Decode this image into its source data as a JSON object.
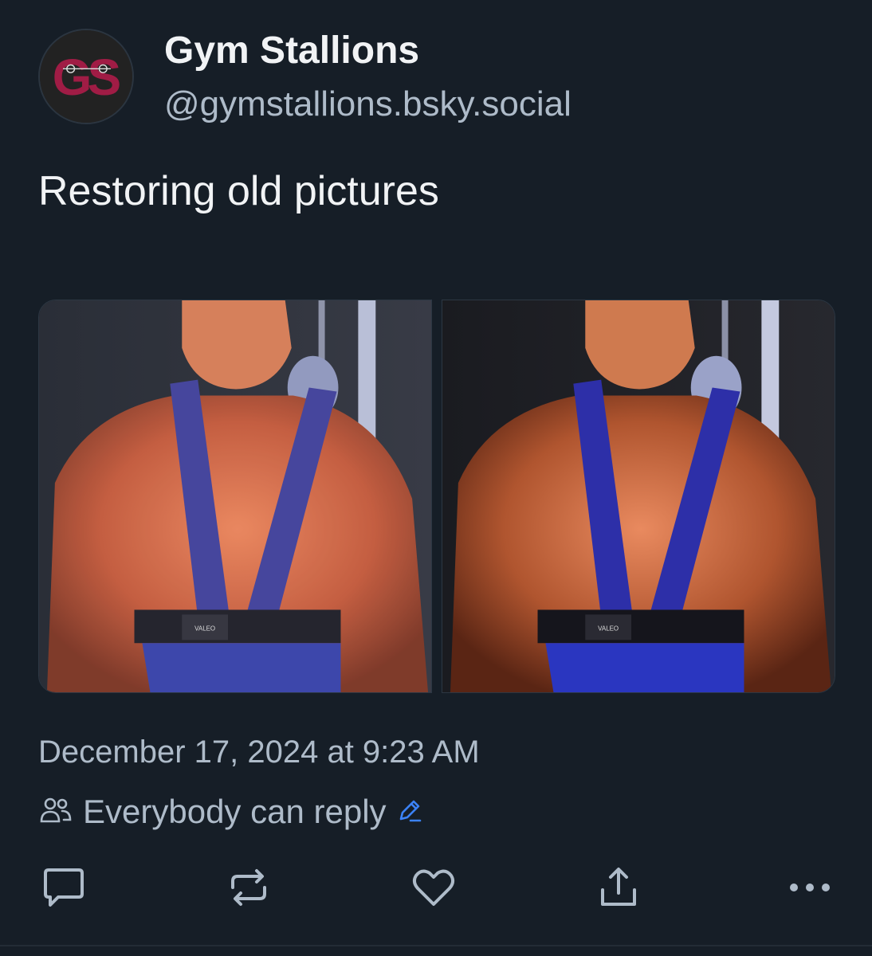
{
  "author": {
    "display_name": "Gym Stallions",
    "handle": "@gymstallions.bsky.social",
    "avatar_logo_text": "GS"
  },
  "post": {
    "text": "Restoring old pictures",
    "images": [
      {
        "belt_label": "VALEO"
      },
      {
        "belt_label": "VALEO"
      }
    ],
    "timestamp": "December 17, 2024 at 9:23 AM",
    "reply_setting": "Everybody can reply"
  },
  "actions": [
    "reply-icon",
    "repost-icon",
    "like-icon",
    "share-icon",
    "more-icon"
  ],
  "colors": {
    "background": "#161e27",
    "text": "#f1f3f5",
    "muted": "#aebbc9",
    "accent": "#3b82f6",
    "logo": "#a01c45"
  }
}
